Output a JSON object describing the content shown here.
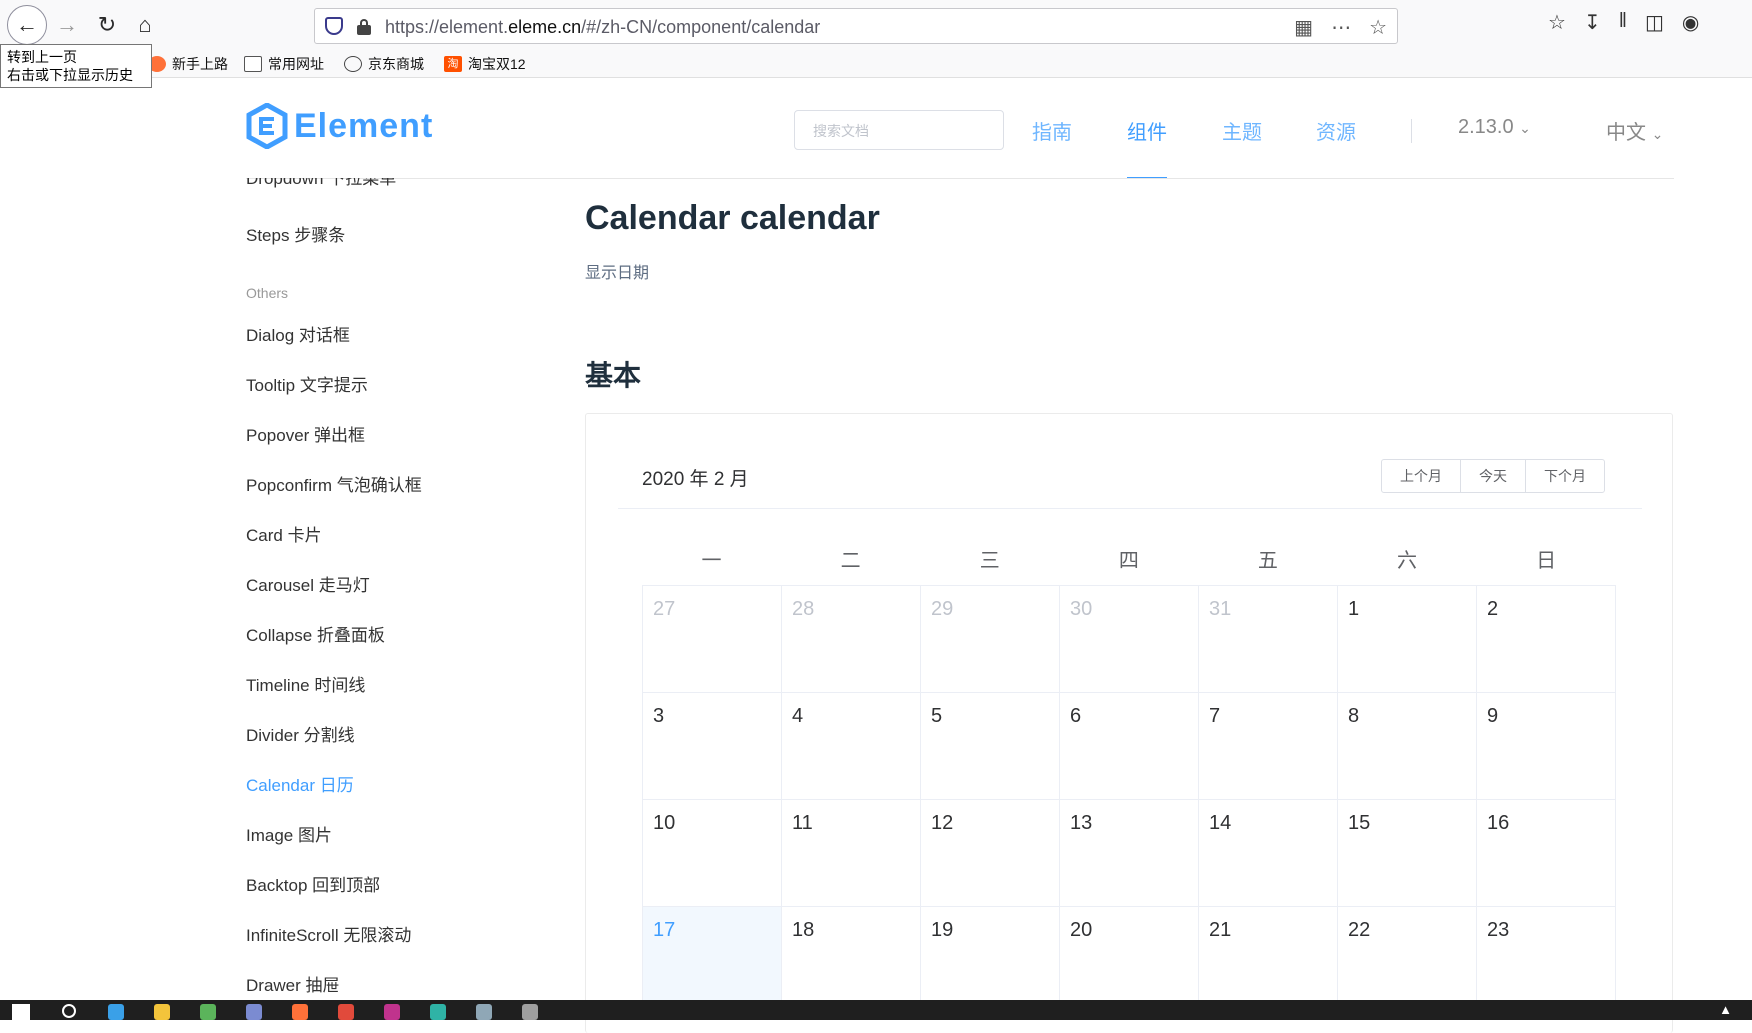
{
  "browser": {
    "url_prefix": "https://element.",
    "url_domain": "eleme.cn",
    "url_path": "/#/zh-CN/component/calendar",
    "tooltip_line1": "转到上一页",
    "tooltip_line2": "右击或下拉显示历史",
    "bookmarks": [
      "新手上路",
      "常用网址",
      "京东商城",
      "淘宝双12"
    ]
  },
  "header": {
    "logo_text": "Element",
    "search_placeholder": "搜索文档",
    "nav": [
      "指南",
      "组件",
      "主题",
      "资源"
    ],
    "version": "2.13.0",
    "language": "中文"
  },
  "sidebar": {
    "top_items": [
      "Dropdown 下拉菜单",
      "Steps 步骤条"
    ],
    "group_label": "Others",
    "items": [
      "Dialog 对话框",
      "Tooltip 文字提示",
      "Popover 弹出框",
      "Popconfirm 气泡确认框",
      "Card 卡片",
      "Carousel 走马灯",
      "Collapse 折叠面板",
      "Timeline 时间线",
      "Divider 分割线",
      "Calendar 日历",
      "Image 图片",
      "Backtop 回到顶部",
      "InfiniteScroll 无限滚动",
      "Drawer 抽屉"
    ]
  },
  "main": {
    "title": "Calendar calendar",
    "description": "显示日期",
    "section_title": "基本",
    "calendar": {
      "title": "2020 年 2 月",
      "buttons": [
        "上个月",
        "今天",
        "下个月"
      ],
      "weekdays": [
        "一",
        "二",
        "三",
        "四",
        "五",
        "六",
        "日"
      ],
      "weeks": [
        [
          "27",
          "28",
          "29",
          "30",
          "31",
          "1",
          "2"
        ],
        [
          "3",
          "4",
          "5",
          "6",
          "7",
          "8",
          "9"
        ],
        [
          "10",
          "11",
          "12",
          "13",
          "14",
          "15",
          "16"
        ],
        [
          "17",
          "18",
          "19",
          "20",
          "21",
          "22",
          "23"
        ]
      ]
    }
  },
  "colors": {
    "accent": "#409eff",
    "muted_day": "#c0c4cc",
    "today_bg": "#f2f8fe"
  }
}
